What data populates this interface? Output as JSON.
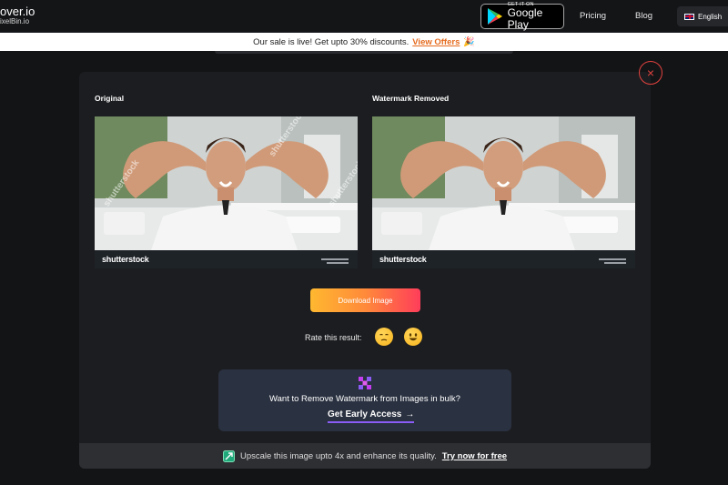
{
  "nav": {
    "logo_line1": "over.io",
    "logo_line2": "ixelBin.io",
    "google_play_small": "GET IT ON",
    "google_play_big": "Google Play",
    "pricing": "Pricing",
    "blog": "Blog",
    "language": "English"
  },
  "banner": {
    "text": "Our sale is live! Get upto 30% discounts.",
    "link": "View Offers",
    "emoji": "🎉"
  },
  "modal": {
    "close_icon": "×",
    "original_label": "Original",
    "removed_label": "Watermark Removed",
    "watermark_brand": "shutterstock",
    "watermark_overlay": "shutterstock",
    "download_button": "Download Image",
    "rate_label": "Rate this result:",
    "rate_icons": [
      "sad-face-icon",
      "smile-face-icon"
    ],
    "bulk_text": "Want to Remove Watermark from Images in bulk?",
    "bulk_link": "Get Early Access",
    "bulk_arrow": "→",
    "upscale_text": "Upscale this image upto 4x and enhance its quality.",
    "upscale_link": "Try now for free"
  },
  "colors": {
    "accent_orange": "#e56b1f",
    "close_red": "#e0423f",
    "bulk_bg": "#2a3140",
    "underline_purple": "#8b5cf6"
  }
}
